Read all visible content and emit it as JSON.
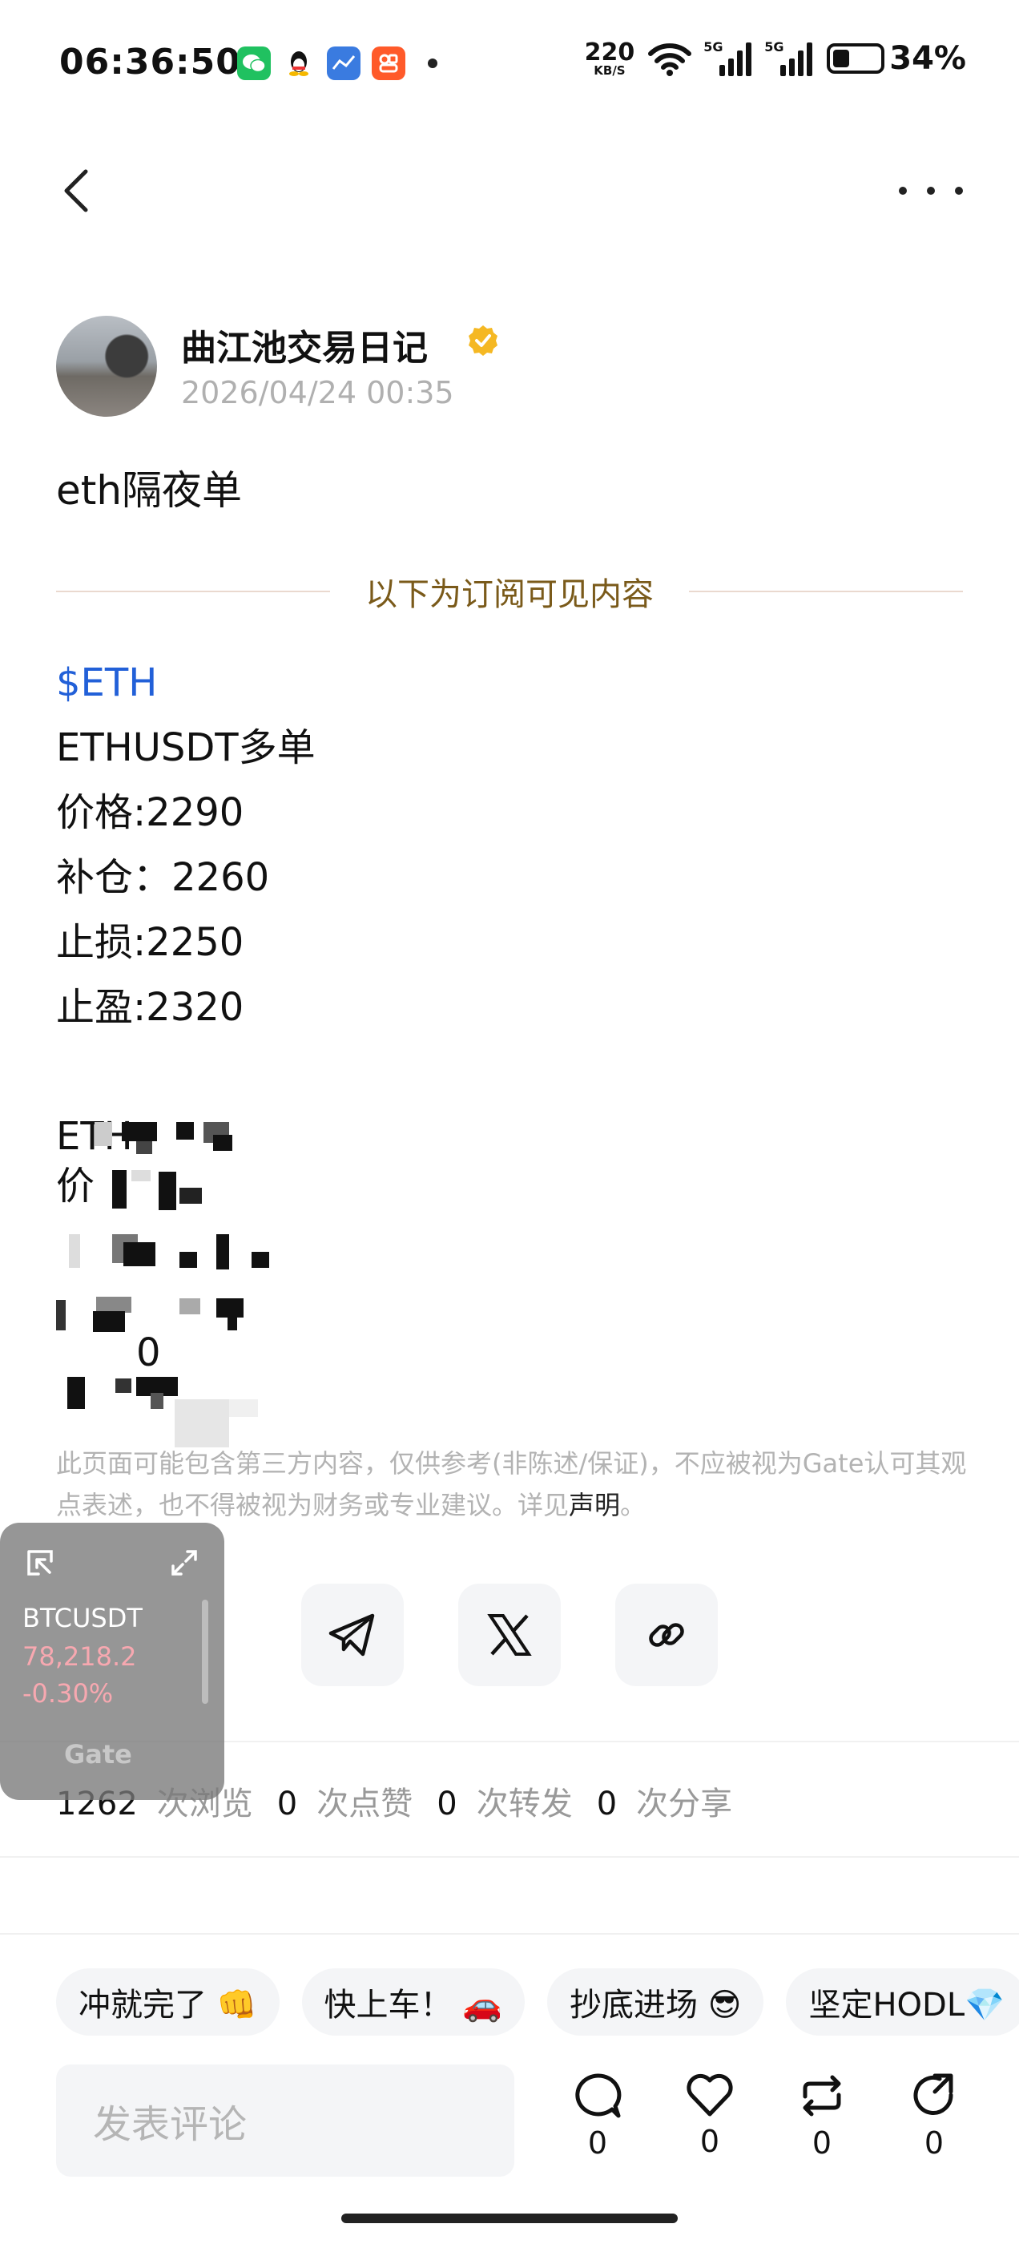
{
  "status_bar": {
    "time": "06:36:50",
    "net_speed": "220",
    "net_unit": "KB/S",
    "signal_1": "5G",
    "signal_2": "5G",
    "battery": "34%"
  },
  "author": {
    "name": "曲江池交易日记",
    "timestamp": "2026/04/24 00:35"
  },
  "post": {
    "title": "eth隔夜单",
    "divider_text": "以下为订阅可见内容",
    "tag": "$ETH",
    "lines": [
      "ETHUSDT多单",
      "价格:2290",
      "补仓：2260",
      "止损:2250",
      "止盈:2320"
    ],
    "blurred_fragments": [
      "ETH",
      "价",
      "0"
    ]
  },
  "disclaimer": {
    "text": "此页面可能包含第三方内容，仅供参考(非陈述/保证)，不应被视为Gate认可其观点表述，也不得被视为财务或专业建议。详见",
    "link": "声明",
    "end": "。"
  },
  "ticker": {
    "symbol": "BTCUSDT",
    "price": "78,218.2",
    "change": "-0.30%",
    "logo": "Gate"
  },
  "stats": {
    "views": "1262",
    "views_label": "次浏览",
    "likes": "0",
    "likes_label": "次点赞",
    "reposts": "0",
    "reposts_label": "次转发",
    "shares": "0",
    "shares_label": "次分享"
  },
  "chips": [
    "冲就完了 👊",
    "快上车！ 🚗",
    "抄底进场 😎",
    "坚定HODL💎"
  ],
  "comment": {
    "placeholder": "发表评论"
  },
  "actions": {
    "comments": "0",
    "likes": "0",
    "reposts": "0",
    "shares": "0"
  },
  "colors": {
    "accent_blue": "#2260d8",
    "gold": "#7a5a1a",
    "verified": "#f5b823",
    "price_red": "#f7a8b0"
  }
}
